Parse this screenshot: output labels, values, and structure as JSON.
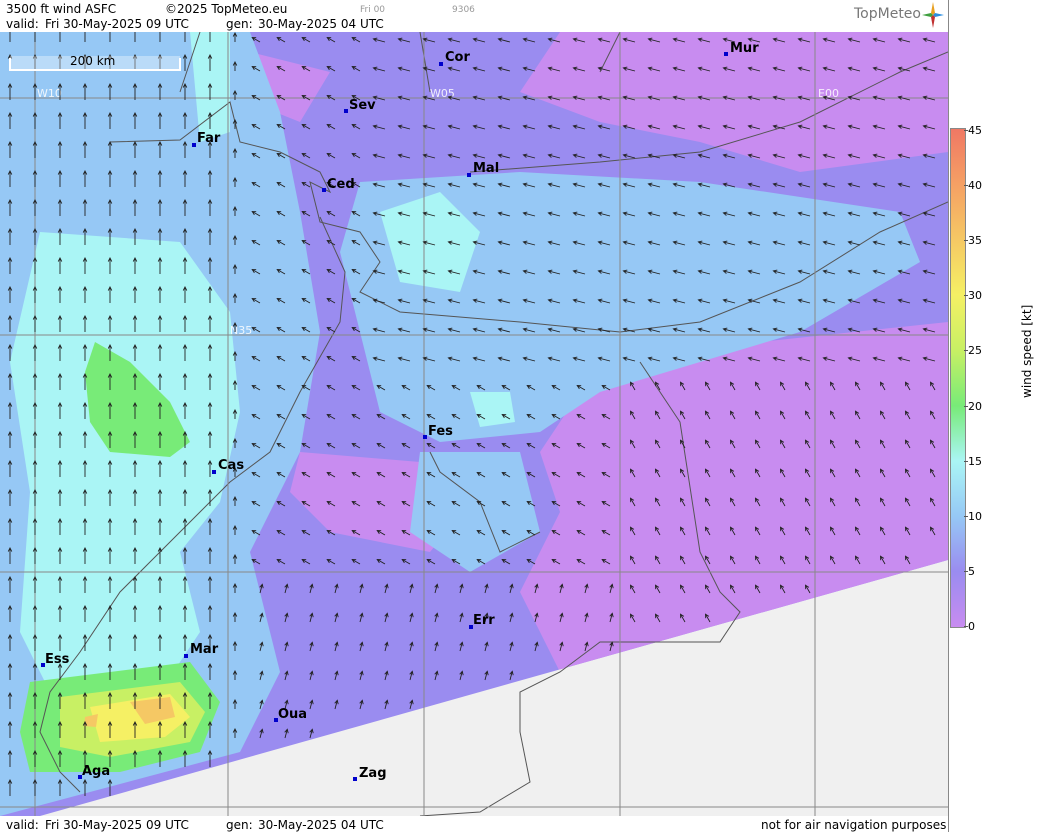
{
  "header": {
    "product": "3500 ft wind ASFC",
    "copyright": "©2025 TopMeteo.eu",
    "run": "Fri 00",
    "code": "9306",
    "valid_label": "valid:",
    "valid_value": "Fri  30-May-2025  09 UTC",
    "gen_label": "gen:",
    "gen_value": "30-May-2025 04 UTC"
  },
  "logo": {
    "text": "TopMeteo",
    "icon": "compass-star-icon"
  },
  "scale": {
    "label": "200 km"
  },
  "grid_labels": [
    {
      "id": "w10",
      "text": "W10"
    },
    {
      "id": "w05",
      "text": "W05"
    },
    {
      "id": "e00",
      "text": "E00"
    },
    {
      "id": "n35",
      "text": "N35"
    }
  ],
  "cities": [
    {
      "id": "cor",
      "name": "Cor"
    },
    {
      "id": "mur",
      "name": "Mur"
    },
    {
      "id": "sev",
      "name": "Sev"
    },
    {
      "id": "far",
      "name": "Far"
    },
    {
      "id": "ced",
      "name": "Ced"
    },
    {
      "id": "mal",
      "name": "Mal"
    },
    {
      "id": "fes",
      "name": "Fes"
    },
    {
      "id": "cas",
      "name": "Cas"
    },
    {
      "id": "err",
      "name": "Err"
    },
    {
      "id": "ess",
      "name": "Ess"
    },
    {
      "id": "mar",
      "name": "Mar"
    },
    {
      "id": "oua",
      "name": "Oua"
    },
    {
      "id": "aga",
      "name": "Aga"
    },
    {
      "id": "zag",
      "name": "Zag"
    }
  ],
  "legend": {
    "title": "wind  speed  [kt]",
    "ticks": [
      "45",
      "40",
      "35",
      "30",
      "25",
      "20",
      "15",
      "10",
      "5",
      "0"
    ],
    "colors": {
      "c0": "#c88cf0",
      "c5": "#9a8cf0",
      "c10": "#96c8f5",
      "c15": "#aaf5f5",
      "c20": "#78eb78",
      "c25": "#c8f064",
      "c30": "#f5f064",
      "c35": "#f5c864",
      "c40": "#f5a064",
      "c45": "#f07864"
    }
  },
  "footer": {
    "valid_label": "valid:",
    "valid_value": "Fri  30-May-2025  09 UTC",
    "gen_label": "gen:",
    "gen_value": "30-May-2025 04 UTC",
    "disclaimer": "not for air navigation purposes"
  }
}
